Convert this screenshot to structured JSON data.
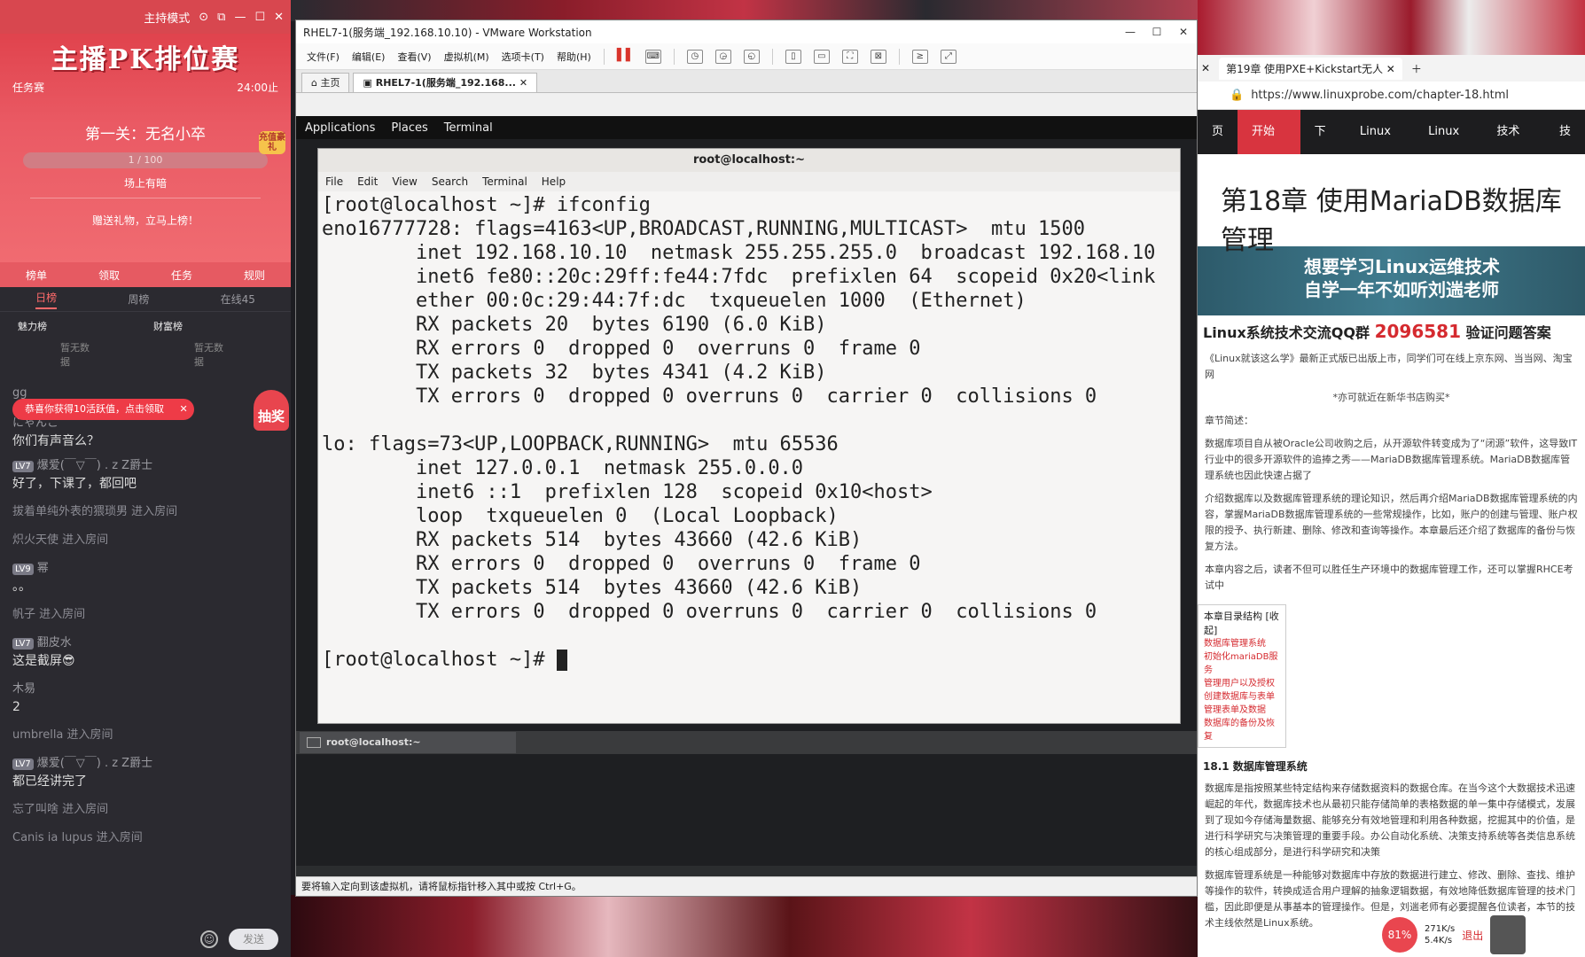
{
  "stream": {
    "mode": "主持模式",
    "event_title": "主播PK排位赛",
    "task_label": "任务赛",
    "deadline": "24:00止",
    "stage": "第一关：无名小卒",
    "progress_text": "1 / 100",
    "reward_note": "场上有暗",
    "gift_note": "赠送礼物，立马上榜！",
    "badge": "充值豪礼",
    "tabs1": [
      "榜单",
      "领取",
      "任务",
      "规则"
    ],
    "tabs2": [
      "日榜",
      "周榜",
      "在线45"
    ],
    "ranks": [
      "魅力榜",
      "财富榜"
    ],
    "no_data": [
      "暂无数据",
      "暂无数据"
    ],
    "toast": "恭喜你获得10活跃值，点击领取",
    "lottery": "抽奖",
    "chat": [
      {
        "user": "gg",
        "text": "",
        "level": ""
      },
      {
        "user": "にゃんこ",
        "text": "你们有声音么？",
        "level": ""
      },
      {
        "user": "爆爱(￣▽￣) . z Z爵士",
        "text": "好了，下课了，都回吧",
        "level": "LV7"
      },
      {
        "user": "",
        "text": "拔着单纯外表的猥琐男 进入房间",
        "level": ""
      },
      {
        "user": "",
        "text": "炽火天使 进入房间",
        "level": ""
      },
      {
        "user": "幂",
        "text": "。。",
        "level": "LV9"
      },
      {
        "user": "",
        "text": "帆子 进入房间",
        "level": ""
      },
      {
        "user": "翻皮水",
        "text": "这是截屏😎",
        "level": "LV7"
      },
      {
        "user": "木易",
        "text": "2",
        "level": ""
      },
      {
        "user": "",
        "text": "umbrella 进入房间",
        "level": ""
      },
      {
        "user": "爆爱(￣▽￣) . z Z爵士",
        "text": "都已经讲完了",
        "level": "LV7"
      },
      {
        "user": "",
        "text": "忘了叫啥 进入房间",
        "level": ""
      },
      {
        "user": "",
        "text": "Canis ia lupus 进入房间",
        "level": ""
      }
    ],
    "send_label": "发送"
  },
  "vmware": {
    "title": "RHEL7-1(服务端_192.168.10.10) - VMware Workstation",
    "menu": [
      "文件(F)",
      "编辑(E)",
      "查看(V)",
      "虚拟机(M)",
      "选项卡(T)",
      "帮助(H)"
    ],
    "tabs": [
      "主页",
      "RHEL7-1(服务端_192.168..."
    ],
    "status_text": "要将输入定向到该虚拟机，请将鼠标指针移入其中或按 Ctrl+G。"
  },
  "gnome": {
    "panel": [
      "Applications",
      "Places",
      "Terminal"
    ],
    "taskbar_item": "root@localhost:~"
  },
  "terminal": {
    "title": "root@localhost:~",
    "menu": [
      "File",
      "Edit",
      "View",
      "Search",
      "Terminal",
      "Help"
    ],
    "lines": [
      "[root@localhost ~]# ifconfig",
      "eno16777728: flags=4163<UP,BROADCAST,RUNNING,MULTICAST>  mtu 1500",
      "        inet 192.168.10.10  netmask 255.255.255.0  broadcast 192.168.10",
      "        inet6 fe80::20c:29ff:fe44:7fdc  prefixlen 64  scopeid 0x20<link",
      "        ether 00:0c:29:44:7f:dc  txqueuelen 1000  (Ethernet)",
      "        RX packets 20  bytes 6190 (6.0 KiB)",
      "        RX errors 0  dropped 0  overruns 0  frame 0",
      "        TX packets 32  bytes 4341 (4.2 KiB)",
      "        TX errors 0  dropped 0 overruns 0  carrier 0  collisions 0",
      "",
      "lo: flags=73<UP,LOOPBACK,RUNNING>  mtu 65536",
      "        inet 127.0.0.1  netmask 255.0.0.0",
      "        inet6 ::1  prefixlen 128  scopeid 0x10<host>",
      "        loop  txqueuelen 0  (Local Loopback)",
      "        RX packets 514  bytes 43660 (42.6 KiB)",
      "        RX errors 0  dropped 0  overruns 0  frame 0",
      "        TX packets 514  bytes 43660 (42.6 KiB)",
      "        TX errors 0  dropped 0 overruns 0  carrier 0  collisions 0",
      "",
      "[root@localhost ~]# "
    ]
  },
  "browser": {
    "tab_title": "第19章 使用PXE+Kickstart无人",
    "url": "https://www.linuxprobe.com/chapter-18.html",
    "nav": [
      "页",
      "开始读书",
      "下载",
      "Linux资讯",
      "Linux书籍",
      "技术干货",
      "技"
    ],
    "heading": "第18章 使用MariaDB数据库管理",
    "ad_line1": "想要学习Linux运维技术",
    "ad_line2": "自学一年不如听刘遄老师",
    "qq_label": "Linux系统技术交流QQ群",
    "qq_number": "2096581",
    "qq_suffix": "验证问题答案",
    "promo": "《Linux就该这么学》最新正式版已出版上市，同学们可在线上京东网、当当网、淘宝网",
    "promo2": "*亦可就近在新华书店购买*",
    "summary_label": "章节简述：",
    "para1": "数据库项目自从被Oracle公司收购之后，从开源软件转变成为了“闭源”软件，这导致IT行业中的很多开源软件的追捧之秀——MariaDB数据库管理系统。MariaDB数据库管理系统也因此快速占据了",
    "para2": "介绍数据库以及数据库管理系统的理论知识，然后再介绍MariaDB数据库管理系统的内容，掌握MariaDB数据库管理系统的一些常规操作，比如，账户的创建与管理、账户权限的授予、执行新建、删除、修改和查询等操作。本章最后还介绍了数据库的备份与恢复方法。",
    "para3": "本章内容之后，读者不但可以胜任生产环境中的数据库管理工作，还可以掌握RHCE考试中",
    "toc_title": "本章目录结构 [收起]",
    "toc": [
      "数据库管理系统",
      "初始化mariaDB服务",
      "管理用户以及授权",
      "创建数据库与表单",
      "管理表单及数据",
      "数据库的备份及恢复"
    ],
    "section": "18.1 数据库管理系统",
    "body1": "数据库是指按照某些特定结构来存储数据资料的数据仓库。在当今这个大数据技术迅速崛起的年代，数据库技术也从最初只能存储简单的表格数据的单一集中存储模式，发展到了现如今存储海量数据、能够充分有效地管理和利用各种数据，挖掘其中的价值，是进行科学研究与决策管理的重要手段。办公自动化系统、决策支持系统等各类信息系统的核心组成部分，是进行科学研究和决策",
    "body2": "数据库管理系统是一种能够对数据库中存放的数据进行建立、修改、删除、查找、维护等操作的软件，转换成适合用户理解的抽象逻辑数据，有效地降低数据库管理的技术门槛，因此即便是从事基本的管理操作。但是，刘遄老师有必要提醒各位读者，本节的技术主线依然是Linux系统。"
  },
  "tray": {
    "percent": "81%",
    "up": "271K/s",
    "down": "5.4K/s",
    "exit": "退出"
  }
}
